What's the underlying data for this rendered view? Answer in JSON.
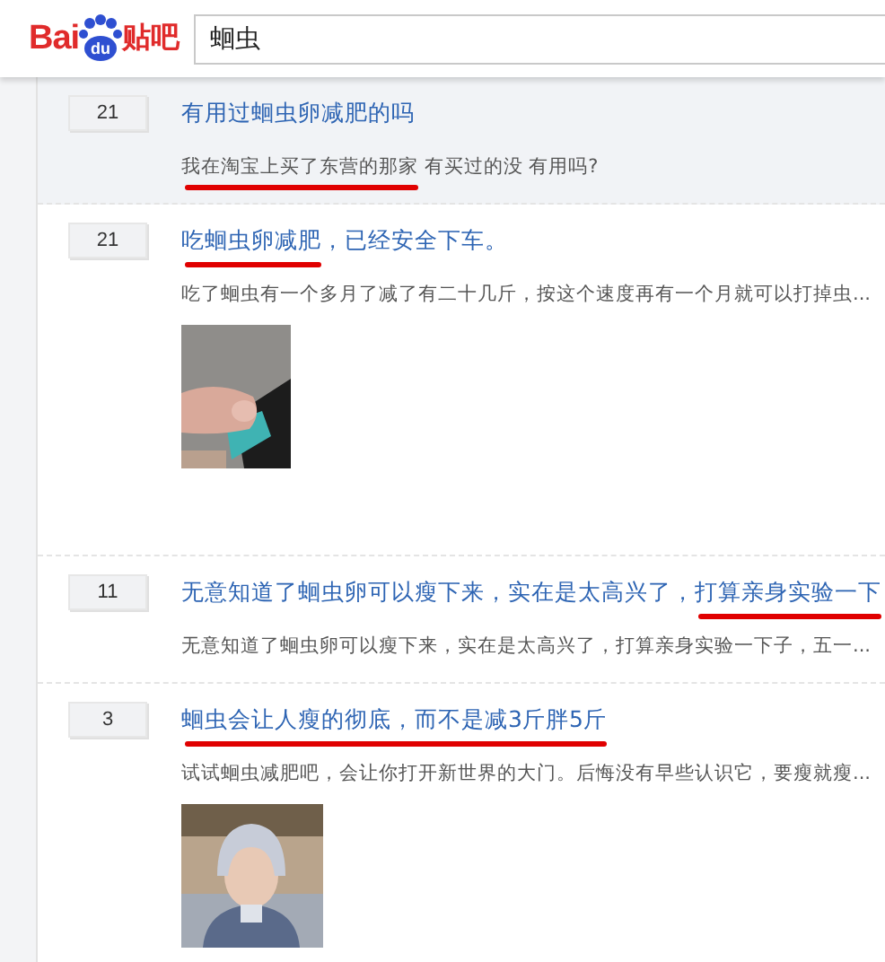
{
  "logo": {
    "left": "Bai",
    "paw": "du",
    "right": "贴吧"
  },
  "search": {
    "value": "蛔虫"
  },
  "posts": [
    {
      "replies": "21",
      "shaded": true,
      "title": [
        {
          "text": "有用过蛔虫卵减肥的吗",
          "underlined": false
        }
      ],
      "snippet": [
        {
          "text": "我在淘宝上买了东营的那家",
          "underlined": true
        },
        {
          "text": " 有买过的没 有用吗?",
          "underlined": false
        }
      ]
    },
    {
      "replies": "21",
      "shaded": false,
      "title": [
        {
          "text": "吃蛔虫卵减肥",
          "underlined": true
        },
        {
          "text": "，已经安全下车。",
          "underlined": false
        }
      ],
      "snippet": [
        {
          "text": "吃了蛔虫有一个多月了减了有二十几斤，按这个速度再有一个月就可以打掉虫...",
          "underlined": false
        }
      ],
      "image": {
        "kind": "picture"
      }
    },
    {
      "replies": "11",
      "shaded": false,
      "title": [
        {
          "text": "无意知道了蛔虫卵可以瘦下来，实在是太高兴了，",
          "underlined": false
        },
        {
          "text": "打算亲身实验一下",
          "underlined": true
        }
      ],
      "snippet": [
        {
          "text": "无意知道了蛔虫卵可以瘦下来，实在是太高兴了，打算亲身实验一下子，五一...",
          "underlined": false
        }
      ]
    },
    {
      "replies": "3",
      "shaded": false,
      "title": [
        {
          "text": "蛔虫会让人瘦的彻底，而不是减3斤胖5斤",
          "underlined": true
        }
      ],
      "snippet": [
        {
          "text": "试试蛔虫减肥吧，会让你打开新世界的大门。后悔没有早些认识它，要瘦就瘦...",
          "underlined": false
        }
      ],
      "image": {
        "kind": "picture"
      }
    }
  ]
}
